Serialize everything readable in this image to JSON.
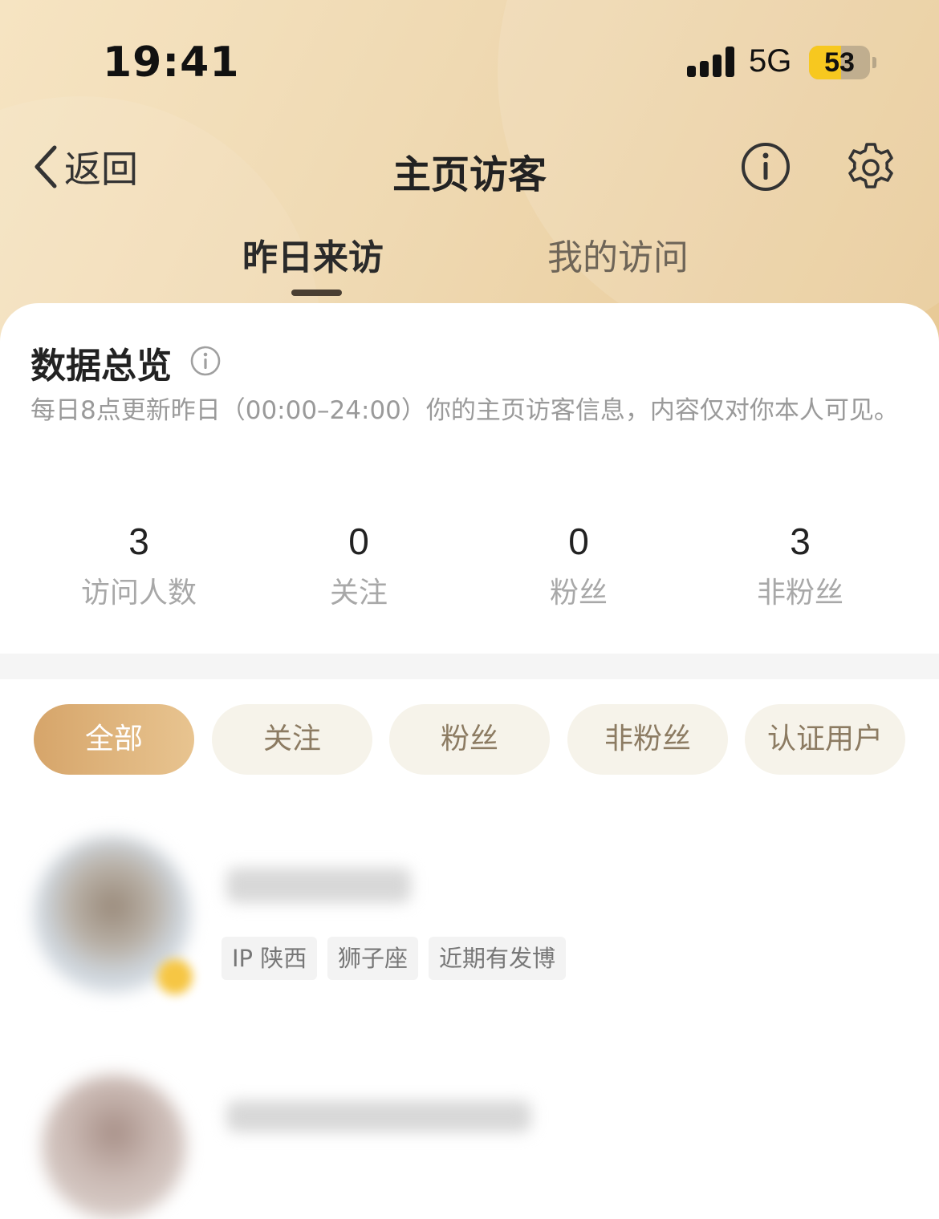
{
  "status_bar": {
    "time": "19:41",
    "network": "5G",
    "battery": 53,
    "battery_label": "53"
  },
  "nav": {
    "back_label": "返回",
    "title": "主页访客",
    "icons": [
      "chevron-left-icon",
      "info-icon",
      "gear-icon"
    ]
  },
  "tabs": [
    {
      "label": "昨日来访",
      "active": true
    },
    {
      "label": "我的访问",
      "active": false
    }
  ],
  "overview": {
    "title": "数据总览",
    "description": "每日8点更新昨日（00:00–24:00）你的主页访客信息，内容仅对你本人可见。",
    "stats": [
      {
        "value": "3",
        "label": "访问人数"
      },
      {
        "value": "0",
        "label": "关注"
      },
      {
        "value": "0",
        "label": "粉丝"
      },
      {
        "value": "3",
        "label": "非粉丝"
      }
    ]
  },
  "filters": [
    {
      "label": "全部",
      "active": true
    },
    {
      "label": "关注",
      "active": false
    },
    {
      "label": "粉丝",
      "active": false
    },
    {
      "label": "非粉丝",
      "active": false
    },
    {
      "label": "认证用户",
      "active": false
    }
  ],
  "visitors": [
    {
      "tags": [
        "IP 陕西",
        "狮子座",
        "近期有发博"
      ]
    }
  ],
  "colors": {
    "accent": "#d6a56a",
    "header_gradient_start": "#f6e4c2",
    "header_gradient_end": "#e8c996",
    "chip_bg": "#f6f3ea",
    "chip_text": "#8c7b62",
    "battery": "#f7c81f"
  }
}
